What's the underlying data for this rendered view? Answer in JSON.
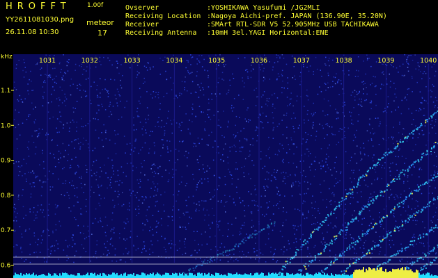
{
  "header": {
    "app_title": "HROFFT",
    "app_version": "1.00f",
    "file_name": "YY2611081030.png",
    "date_time": "26.11.08 10:30",
    "meteor_label": "meteor",
    "meteor_count": "17"
  },
  "info": [
    {
      "label": "Ovserver",
      "value": ":YOSHIKAWA Yasufumi /JG2MLI"
    },
    {
      "label": "Receiving Location",
      "value": ":Nagoya Aichi-pref. JAPAN (136.90E, 35.20N)"
    },
    {
      "label": "Receiver",
      "value": ":SMArt RTL-SDR V5 52.905MHz USB TACHIKAWA"
    },
    {
      "label": "Receiving Antenna",
      "value": ":10mH 3el.YAGI Horizontal:ENE"
    }
  ],
  "axis": {
    "y_unit": "kHz",
    "y_ticks": [
      "1.1",
      "1.0",
      "0.9",
      "0.8",
      "0.7",
      "0.6"
    ],
    "x_ticks": [
      "1031",
      "1032",
      "1033",
      "1034",
      "1035",
      "1036",
      "1037",
      "1038",
      "1039",
      "1040"
    ]
  },
  "colors": {
    "background": "#0a0a5a",
    "header_text": "#ffff33",
    "noise": "#3355ff",
    "signal": "#33ccee",
    "signal_hot": "#ffff44",
    "baseline": "#22ddff"
  }
}
